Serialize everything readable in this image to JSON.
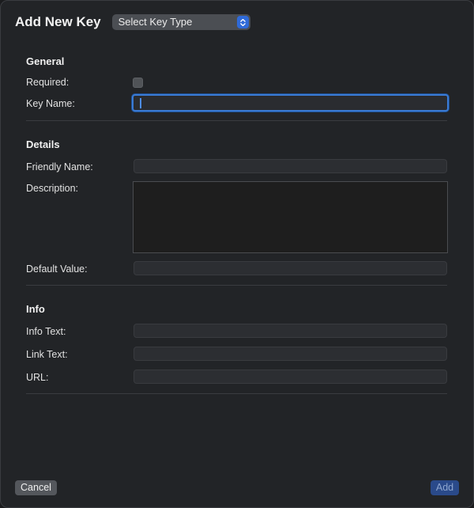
{
  "dialog": {
    "title": "Add New Key",
    "key_type_select": {
      "selected": "Select Key Type"
    }
  },
  "sections": {
    "general": {
      "title": "General",
      "required_label": "Required:",
      "required_checked": false,
      "key_name_label": "Key Name:",
      "key_name_value": ""
    },
    "details": {
      "title": "Details",
      "friendly_name_label": "Friendly Name:",
      "friendly_name_value": "",
      "description_label": "Description:",
      "description_value": "",
      "default_value_label": "Default Value:",
      "default_value_value": ""
    },
    "info": {
      "title": "Info",
      "info_text_label": "Info Text:",
      "info_text_value": "",
      "link_text_label": "Link Text:",
      "link_text_value": "",
      "url_label": "URL:",
      "url_value": ""
    }
  },
  "footer": {
    "cancel_label": "Cancel",
    "add_label": "Add"
  },
  "colors": {
    "accent": "#3a7bd5",
    "background": "#222427",
    "disabled_button": "#2a4a8a"
  },
  "icons": {
    "select_arrows": "chevron-up-down-icon"
  }
}
